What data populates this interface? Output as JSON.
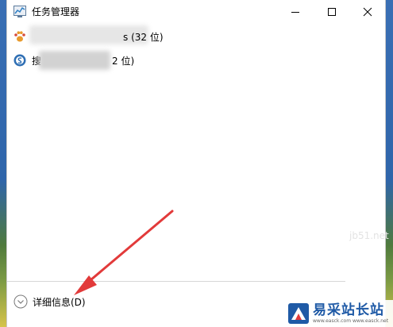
{
  "window": {
    "title": "任务管理器"
  },
  "processes": [
    {
      "name_visible": "s (32 位)",
      "icon": "baidu-paw-icon"
    },
    {
      "name_prefix": "搜",
      "name_visible": "2 位)",
      "icon": "sogou-icon"
    }
  ],
  "footer": {
    "details_label": "详细信息(D)"
  },
  "watermark": {
    "title": "易采站长站",
    "subtitle": "www.easck.com  www.easck.net",
    "faint": "jb51.net"
  },
  "colors": {
    "arrow": "#e23a3a",
    "watermark_blue": "#1f5aa6"
  }
}
